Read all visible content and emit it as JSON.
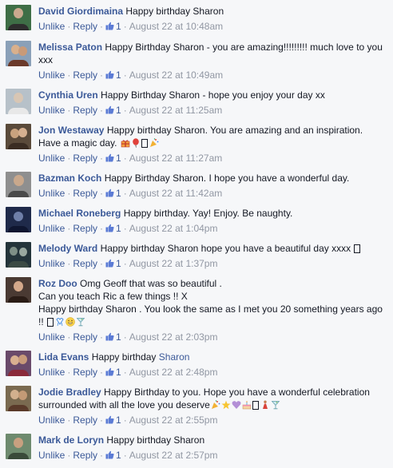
{
  "actions": {
    "unlike": "Unlike",
    "reply": "Reply",
    "sep": "·"
  },
  "comments": [
    {
      "author": "David Giordimaina",
      "text": "Happy birthday Sharon",
      "likes": "1",
      "time": "August 22 at 10:48am",
      "avatar": [
        "#3e6e46",
        "#c9a98f",
        "#2d2d2d"
      ]
    },
    {
      "author": "Melissa Paton",
      "text": "Happy Birthday Sharon - you are amazing!!!!!!!!! much love to you xxx",
      "likes": "1",
      "time": "August 22 at 10:49am",
      "avatar": [
        "#8aa0b8",
        "#d9b08c",
        "#6b3a2a"
      ]
    },
    {
      "author": "Cynthia Uren",
      "text": "Happy Birthday Sharon - hope you enjoy your day xx",
      "likes": "1",
      "time": "August 22 at 11:25am",
      "avatar": [
        "#b7c1c9",
        "#d8c6b4",
        "#e8e8e8"
      ]
    },
    {
      "author": "Jon Westaway",
      "text": "Happy birthday Sharon. You are amazing and an inspiration. Have a magic day.",
      "likes": "1",
      "time": "August 22 at 11:27am",
      "avatar": [
        "#5a4a3a",
        "#c8a27e",
        "#3a2c22"
      ]
    },
    {
      "author": "Bazman Koch",
      "text": "Happy Birthday Sharon. I hope you have a wonderful day.",
      "likes": "1",
      "time": "August 22 at 11:42am",
      "avatar": [
        "#8f8f8f",
        "#c9a88c",
        "#4a4a4a"
      ]
    },
    {
      "author": "Michael Roneberg",
      "text": "Happy birthday. Yay! Enjoy. Be naughty.",
      "likes": "1",
      "time": "August 22 at 1:04pm",
      "avatar": [
        "#1f2a4a",
        "#6f7fa8",
        "#0f1630"
      ]
    },
    {
      "author": "Melody Ward",
      "text": "Happy birthday Sharon hope you have a beautiful day xxxx",
      "likes": "1",
      "time": "August 22 at 1:37pm",
      "avatar": [
        "#24343a",
        "#7e8f86",
        "#3b4a44"
      ]
    },
    {
      "author": "Roz Doo",
      "text_lines": [
        "Omg Geoff that was so beautiful .",
        "Can you teach Ric a few things !! X",
        "Happy birthday Sharon . You look the same as I met you 20 something years ago !!"
      ],
      "likes": "1",
      "time": "August 22 at 2:03pm",
      "avatar": [
        "#4a3a33",
        "#d4a88a",
        "#2a1c16"
      ]
    },
    {
      "author": "Lida Evans",
      "text": "Happy birthday",
      "mention": "Sharon",
      "likes": "1",
      "time": "August 22 at 2:48pm",
      "avatar": [
        "#6a4a6a",
        "#d8b090",
        "#8a2a3a"
      ]
    },
    {
      "author": "Jodie Bradley",
      "text": "Happy Birthday to you. Hope you have a wonderful celebration surrounded with all the love you deserve",
      "likes": "1",
      "time": "August 22 at 2:55pm",
      "avatar": [
        "#7a6a50",
        "#d2b08e",
        "#5a3a2a"
      ]
    },
    {
      "author": "Mark de Loryn",
      "text": "Happy birthday Sharon",
      "likes": "1",
      "time": "August 22 at 2:57pm",
      "avatar": [
        "#6e8a6e",
        "#c8a080",
        "#3a4a3a"
      ]
    }
  ]
}
